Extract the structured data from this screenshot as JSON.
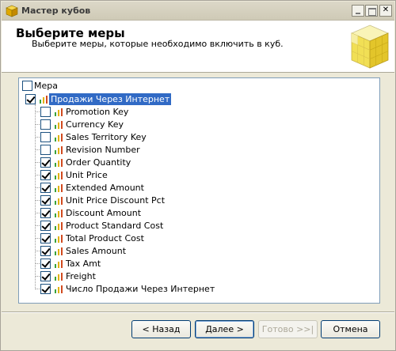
{
  "window": {
    "title": "Мастер кубов"
  },
  "header": {
    "title": "Выберите меры",
    "subtitle": "Выберите меры, которые необходимо включить в куб."
  },
  "tree": {
    "column_header": "Мера",
    "column_header_checked": false,
    "root": {
      "label": "Продажи Через Интернет",
      "checked": true,
      "selected": true
    },
    "items": [
      {
        "label": "Promotion Key",
        "checked": false
      },
      {
        "label": "Currency Key",
        "checked": false
      },
      {
        "label": "Sales Territory Key",
        "checked": false
      },
      {
        "label": "Revision Number",
        "checked": false
      },
      {
        "label": "Order Quantity",
        "checked": true
      },
      {
        "label": "Unit Price",
        "checked": true
      },
      {
        "label": "Extended Amount",
        "checked": true
      },
      {
        "label": "Unit Price Discount Pct",
        "checked": true
      },
      {
        "label": "Discount Amount",
        "checked": true
      },
      {
        "label": "Product Standard Cost",
        "checked": true
      },
      {
        "label": "Total Product Cost",
        "checked": true
      },
      {
        "label": "Sales Amount",
        "checked": true
      },
      {
        "label": "Tax Amt",
        "checked": true
      },
      {
        "label": "Freight",
        "checked": true
      },
      {
        "label": "Число Продажи Через Интернет",
        "checked": true
      }
    ]
  },
  "buttons": {
    "back": "< Назад",
    "next": "Далее >",
    "finish": "Готово >>|",
    "cancel": "Отмена"
  },
  "icons": {
    "app": "cube-icon",
    "measure": "measure-bar-chart-icon",
    "header_art": "cube-wizard-art"
  }
}
